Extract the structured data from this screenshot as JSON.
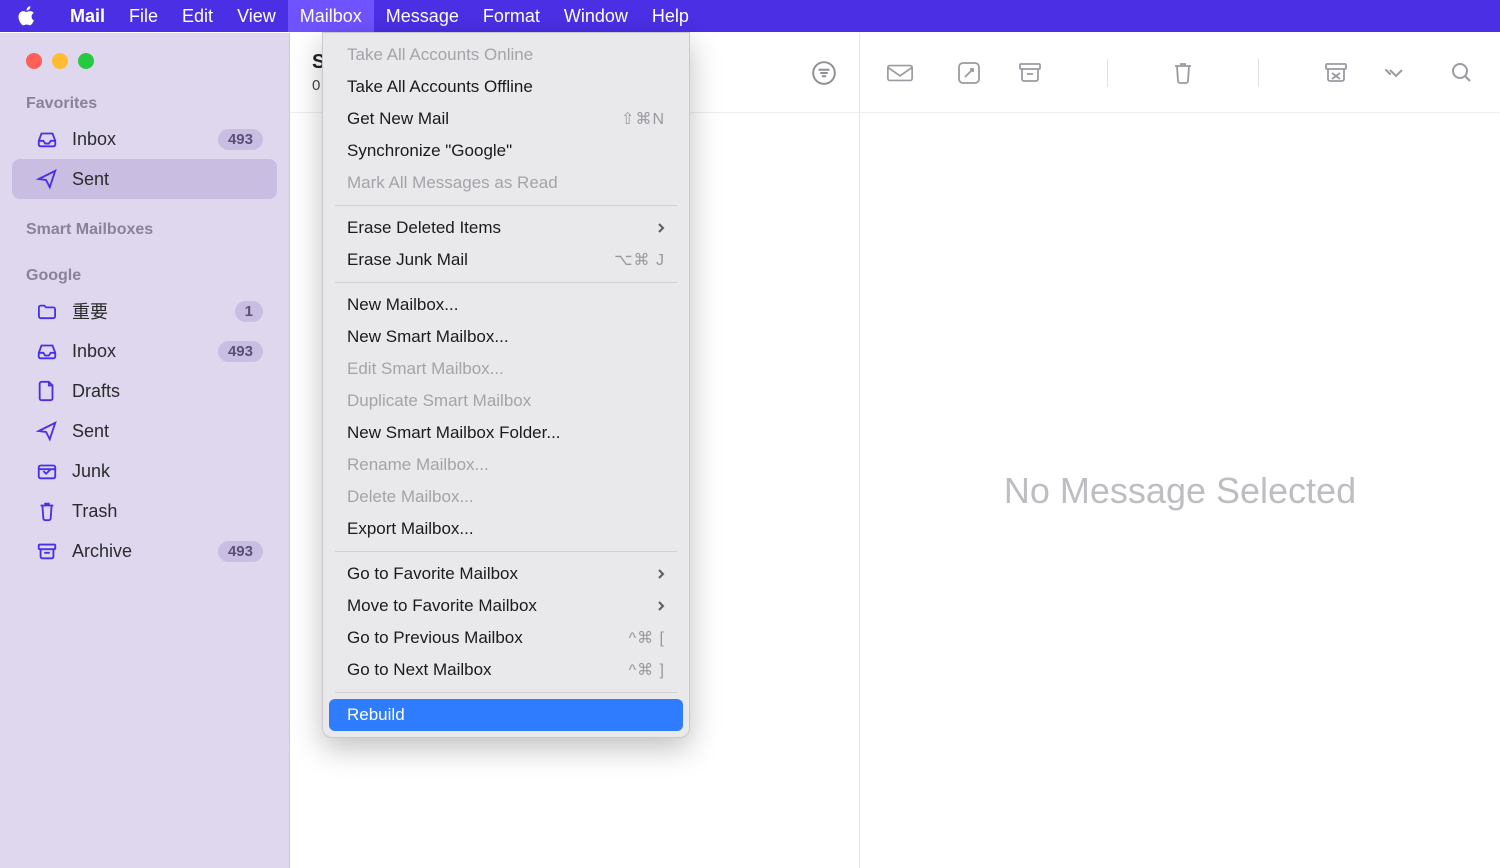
{
  "menubar": {
    "appName": "Mail",
    "items": [
      "File",
      "Edit",
      "View",
      "Mailbox",
      "Message",
      "Format",
      "Window",
      "Help"
    ],
    "activeIndex": 3
  },
  "sidebar": {
    "sections": {
      "favorites": "Favorites",
      "smart": "Smart Mailboxes",
      "google": "Google"
    },
    "favItems": [
      {
        "label": "Inbox",
        "badge": "493",
        "icon": "inbox"
      },
      {
        "label": "Sent",
        "badge": "",
        "icon": "sent"
      }
    ],
    "selectedFavIndex": 1,
    "googleItems": [
      {
        "label": "重要",
        "badge": "1",
        "icon": "folder"
      },
      {
        "label": "Inbox",
        "badge": "493",
        "icon": "inbox"
      },
      {
        "label": "Drafts",
        "badge": "",
        "icon": "drafts"
      },
      {
        "label": "Sent",
        "badge": "",
        "icon": "sent"
      },
      {
        "label": "Junk",
        "badge": "",
        "icon": "junk"
      },
      {
        "label": "Trash",
        "badge": "",
        "icon": "trash"
      },
      {
        "label": "Archive",
        "badge": "493",
        "icon": "archive"
      }
    ]
  },
  "midcol": {
    "titleInitial": "S",
    "subPrefix": "0"
  },
  "reader": {
    "emptyText": "No Message Selected"
  },
  "dropdown": {
    "groups": [
      [
        {
          "label": "Take All Accounts Online",
          "disabled": true
        },
        {
          "label": "Take All Accounts Offline"
        },
        {
          "label": "Get New Mail",
          "shortcut": "⇧⌘N"
        },
        {
          "label": "Synchronize \"Google\""
        },
        {
          "label": "Mark All Messages as Read",
          "disabled": true
        }
      ],
      [
        {
          "label": "Erase Deleted Items",
          "submenu": true
        },
        {
          "label": "Erase Junk Mail",
          "shortcut": "⌥⌘ J"
        }
      ],
      [
        {
          "label": "New Mailbox..."
        },
        {
          "label": "New Smart Mailbox..."
        },
        {
          "label": "Edit Smart Mailbox...",
          "disabled": true
        },
        {
          "label": "Duplicate Smart Mailbox",
          "disabled": true
        },
        {
          "label": "New Smart Mailbox Folder..."
        },
        {
          "label": "Rename Mailbox...",
          "disabled": true
        },
        {
          "label": "Delete Mailbox...",
          "disabled": true
        },
        {
          "label": "Export Mailbox..."
        }
      ],
      [
        {
          "label": "Go to Favorite Mailbox",
          "submenu": true
        },
        {
          "label": "Move to Favorite Mailbox",
          "submenu": true
        },
        {
          "label": "Go to Previous Mailbox",
          "shortcut": "^⌘ ["
        },
        {
          "label": "Go to Next Mailbox",
          "shortcut": "^⌘ ]"
        }
      ],
      [
        {
          "label": "Rebuild",
          "highlight": true
        }
      ]
    ]
  }
}
